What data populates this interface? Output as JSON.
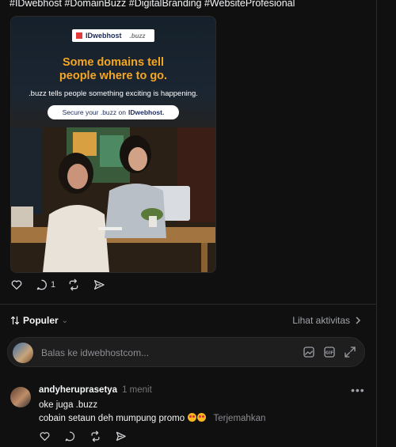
{
  "post": {
    "hashtags": "#IDwebhost #DomainBuzz #DigitalBranding #WebsiteProfesional",
    "ad": {
      "brand": "IDwebhost",
      "brand_partner": ".buzz",
      "headline_1": "Some domains tell",
      "headline_2": "people where to go.",
      "subline": ".buzz tells people something exciting is happening.",
      "cta_prefix": "Secure your .buzz on",
      "cta_brand": "IDwebhost."
    },
    "actions": {
      "reply_count": "1"
    }
  },
  "sort": {
    "label": "Populer",
    "activity_label": "Lihat aktivitas"
  },
  "reply_box": {
    "placeholder": "Balas ke idwebhostcom..."
  },
  "comment": {
    "username": "andyheruprasetya",
    "time": "1 menit",
    "line1": "oke juga .buzz",
    "line2": "cobain setaun deh mumpung promo",
    "translate": "Terjemahkan"
  },
  "colors": {
    "background": "#101010",
    "accent_headline": "#f5a623",
    "text_primary": "#f3f5f7",
    "text_muted": "#8a8d92"
  }
}
